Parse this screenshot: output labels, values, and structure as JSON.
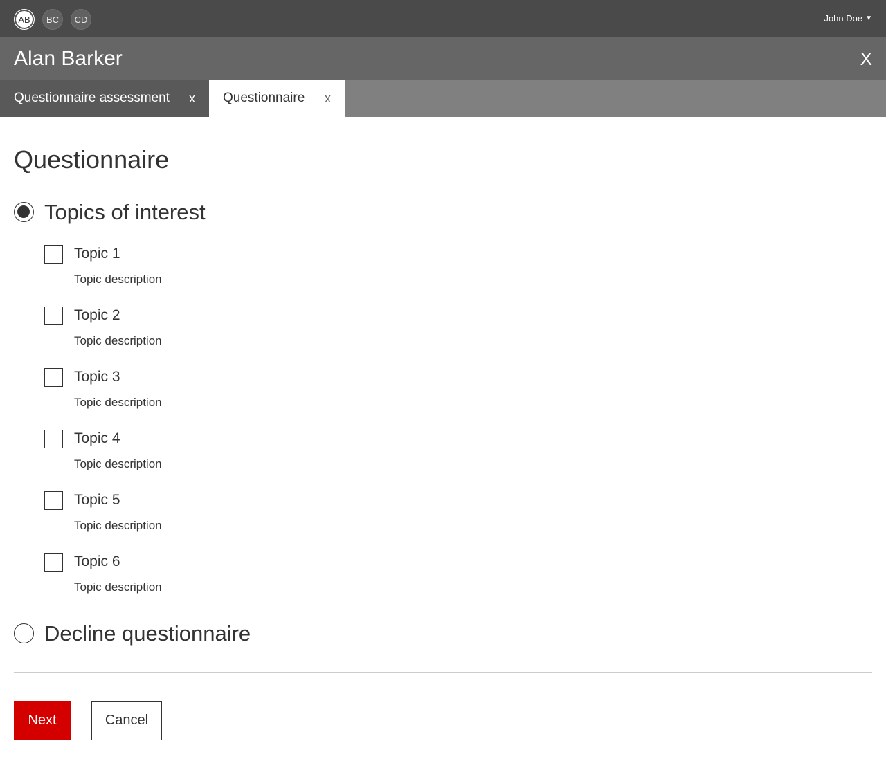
{
  "topbar": {
    "avatars": [
      "AB",
      "BC",
      "CD"
    ],
    "active_avatar": "AB",
    "user_name": "John Doe",
    "user_caret": "▼"
  },
  "header": {
    "title": "Alan Barker",
    "close_label": "X"
  },
  "tabs": [
    {
      "label": "Questionnaire assessment",
      "close": "x",
      "active": false
    },
    {
      "label": "Questionnaire",
      "close": "x",
      "active": true
    }
  ],
  "main": {
    "title": "Questionnaire",
    "options": [
      {
        "label": "Topics of interest",
        "selected": true
      },
      {
        "label": "Decline questionnaire",
        "selected": false
      }
    ],
    "topics": [
      {
        "label": "Topic 1",
        "description": "Topic description",
        "checked": false
      },
      {
        "label": "Topic 2",
        "description": "Topic description",
        "checked": false
      },
      {
        "label": "Topic 3",
        "description": "Topic description",
        "checked": false
      },
      {
        "label": "Topic 4",
        "description": "Topic description",
        "checked": false
      },
      {
        "label": "Topic 5",
        "description": "Topic description",
        "checked": false
      },
      {
        "label": "Topic 6",
        "description": "Topic description",
        "checked": false
      }
    ]
  },
  "actions": {
    "next_label": "Next",
    "cancel_label": "Cancel"
  },
  "colors": {
    "topbar": "#4a4a4a",
    "header": "#666666",
    "tabbar": "#808080",
    "tab_inactive": "#595959",
    "primary": "#d40000",
    "text": "#333333"
  }
}
